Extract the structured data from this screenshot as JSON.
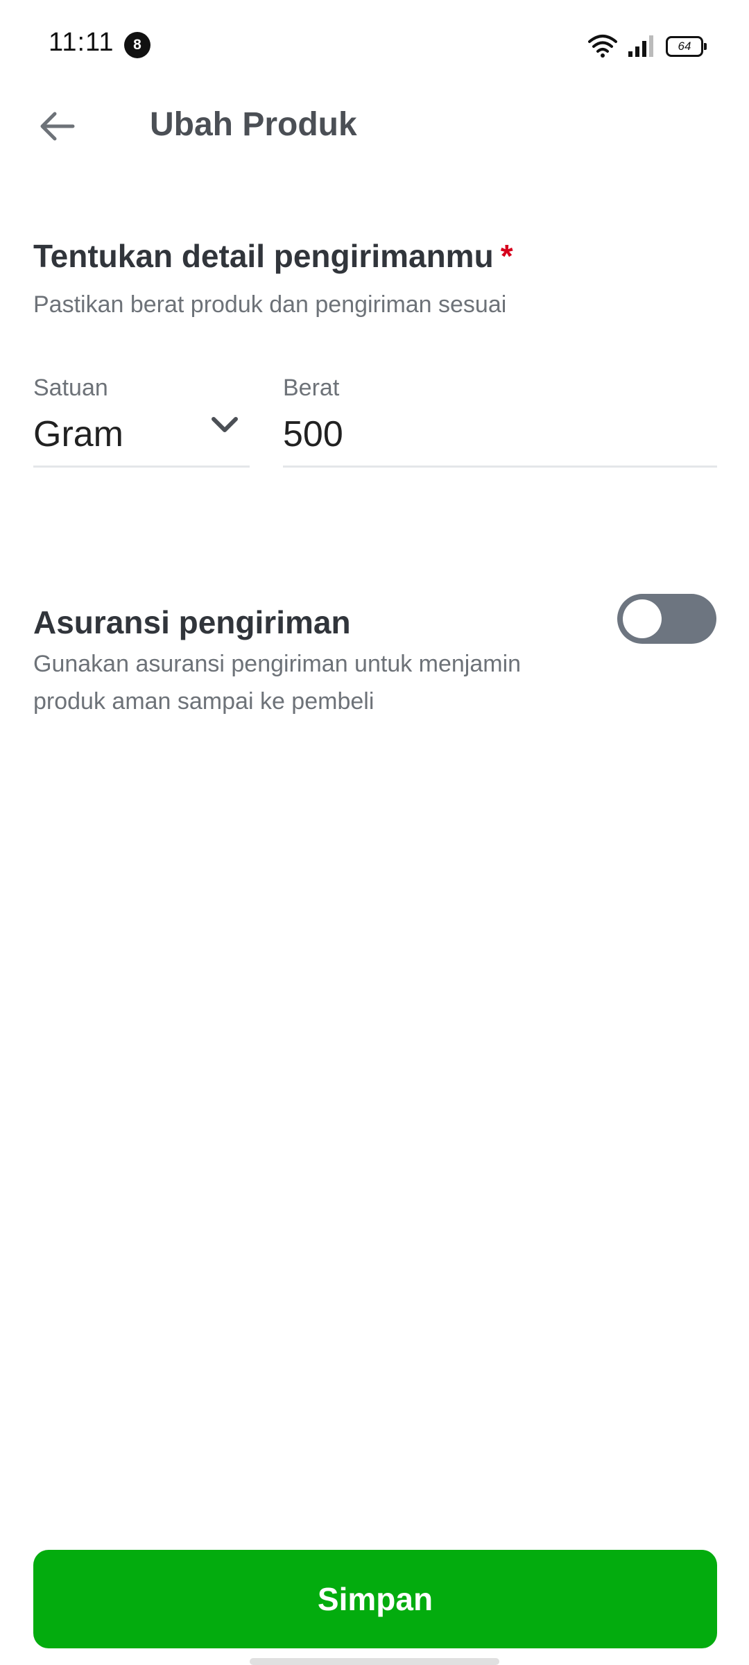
{
  "status_bar": {
    "time": "11:11",
    "notification_count": "8",
    "battery_level": "64"
  },
  "header": {
    "title": "Ubah Produk",
    "back_icon": "arrow-left-icon"
  },
  "shipping": {
    "title": "Tentukan detail pengirimanmu",
    "required_mark": "*",
    "subtitle": "Pastikan berat produk dan pengiriman sesuai",
    "unit_label": "Satuan",
    "unit_value": "Gram",
    "weight_label": "Berat",
    "weight_value": "500"
  },
  "insurance": {
    "title": "Asuransi pengiriman",
    "description": "Gunakan asuransi pengiriman untuk menjamin produk aman sampai ke pembeli",
    "enabled": false
  },
  "footer": {
    "save_label": "Simpan"
  },
  "colors": {
    "primary": "#03ac0e",
    "required": "#d6001c",
    "toggle_off": "#6d7580"
  }
}
